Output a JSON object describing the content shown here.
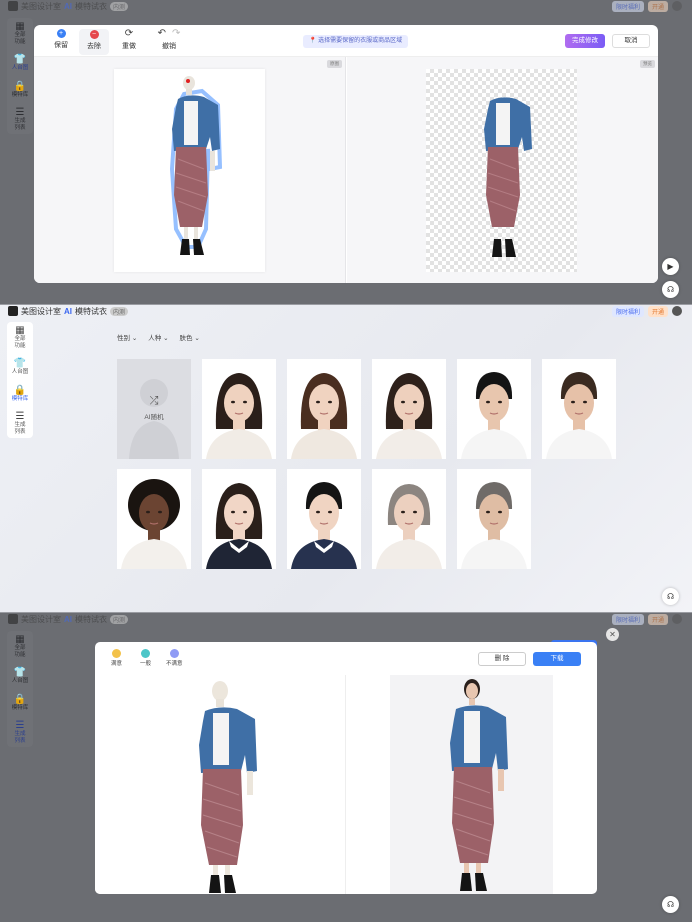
{
  "app": {
    "brand": "美图设计室",
    "product": "AI",
    "product_name": "模特试衣",
    "tag": "内测"
  },
  "topright": {
    "trial": "限时福利",
    "vip": "开通"
  },
  "sidebar": {
    "items": [
      {
        "icon": "grid-icon",
        "label1": "全部",
        "label2": "功能"
      },
      {
        "icon": "shirt-icon",
        "label1": "人台图",
        "label2": ""
      },
      {
        "icon": "lock-icon",
        "label1": "模特库",
        "label2": ""
      },
      {
        "icon": "list-icon",
        "label1": "生成",
        "label2": "列表"
      }
    ]
  },
  "panel1": {
    "tools": [
      {
        "label": "保留",
        "color": "#3a80f5",
        "glyph": "+"
      },
      {
        "label": "去除",
        "color": "#e5484d",
        "glyph": "−"
      },
      {
        "label": "重做",
        "glyph": "⟳"
      },
      {
        "label": "撤销",
        "glyph": "↶ ↷"
      }
    ],
    "hint": "选择需要保留的衣服或商品区域",
    "done_label": "完成修改",
    "cancel_label": "取消",
    "left_tag": "原图",
    "right_tag": "预览"
  },
  "panel2": {
    "filters": [
      {
        "label": "性别"
      },
      {
        "label": "人种"
      },
      {
        "label": "肤色"
      }
    ],
    "random_label": "AI随机",
    "faces": [
      {
        "name": "random"
      },
      {
        "name": "asian-woman-1"
      },
      {
        "name": "asian-woman-2"
      },
      {
        "name": "asian-woman-3"
      },
      {
        "name": "asian-man-1"
      },
      {
        "name": "western-man-1"
      },
      {
        "name": "african-woman"
      },
      {
        "name": "asian-girl"
      },
      {
        "name": "asian-boy"
      },
      {
        "name": "asian-older-woman"
      },
      {
        "name": "asian-older-man"
      }
    ]
  },
  "panel3": {
    "ratings": [
      {
        "label": "满意",
        "color": "#f3c24a"
      },
      {
        "label": "一般",
        "color": "#4cc6c8"
      },
      {
        "label": "不满意",
        "color": "#8f9bf5"
      }
    ],
    "delete_label": "删 除",
    "download_label": "下载"
  },
  "colors": {
    "accent": "#3a80f5",
    "purple": "#8a5cf5",
    "denim": "#3d6fa5",
    "skirt": "#9a6167"
  }
}
